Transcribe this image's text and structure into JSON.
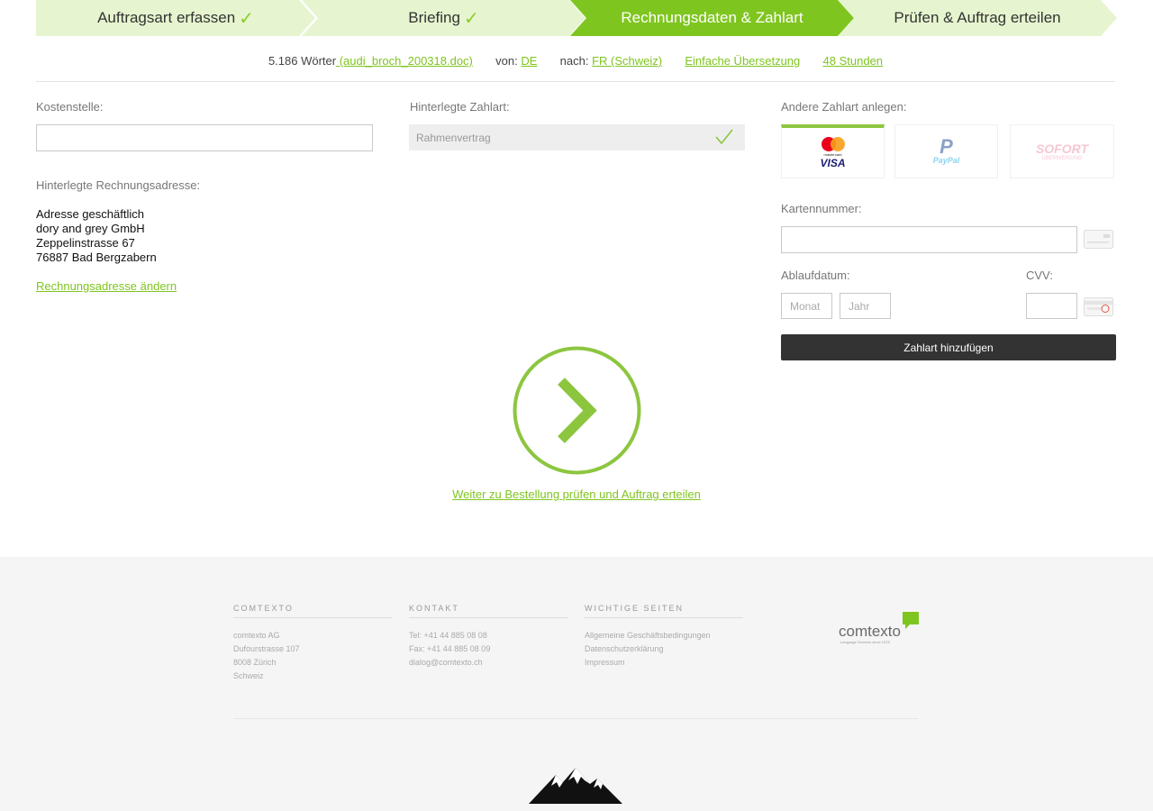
{
  "steps": [
    {
      "label": "Auftragsart erfassen",
      "done": true
    },
    {
      "label": "Briefing",
      "done": true
    },
    {
      "label": "Rechnungsdaten & Zahlart",
      "active": true
    },
    {
      "label": "Prüfen & Auftrag erteilen"
    }
  ],
  "summary": {
    "words": "5.186 Wörter",
    "file": " (audi_broch_200318.doc)",
    "from_label": "von:",
    "from_value": "DE",
    "to_label": "nach:",
    "to_value": "FR (Schweiz)",
    "type": "Einfache Übersetzung",
    "duration": "48 Stunden"
  },
  "left": {
    "cost_center_label": "Kostenstelle:",
    "cost_center_value": "",
    "address_label": "Hinterlegte Rechnungsadresse:",
    "address_lines": [
      "Adresse geschäftlich",
      "dory and grey GmbH",
      "Zeppelinstrasse 67",
      "76887 Bad Bergzabern"
    ],
    "change_address_link": "Rechnungsadresse ändern"
  },
  "middle": {
    "payment_label": "Hinterlegte Zahlart:",
    "payment_value": "Rahmenvertrag"
  },
  "right": {
    "new_payment_label": "Andere Zahlart anlegen:",
    "tabs": [
      {
        "name": "mastercard-visa",
        "text_top": "mastercard",
        "text_bottom": "VISA"
      },
      {
        "name": "paypal",
        "text": "PayPal"
      },
      {
        "name": "sofort",
        "text_top": "SOFORT",
        "text_bottom": "ÜBERWEISUNG"
      }
    ],
    "card_number_label": "Kartennummer:",
    "expiry_label": "Ablaufdatum:",
    "month_placeholder": "Monat",
    "year_placeholder": "Jahr",
    "cvv_label": "CVV:",
    "add_button": "Zahlart hinzufügen"
  },
  "next": {
    "link": "Weiter zu Bestellung prüfen und Auftrag erteilen"
  },
  "footer": {
    "col1_head": "COMTEXTO",
    "col1_lines": [
      "comtexto AG",
      "Dufourstrasse 107",
      "8008 Zürich",
      "Schweiz"
    ],
    "col2_head": "KONTAKT",
    "col2_lines": [
      "Tel: +41 44 885 08 08",
      "Fax: +41 44 885 08 09",
      "dialog@comtexto.ch"
    ],
    "col3_head": "WICHTIGE SEITEN",
    "col3_lines": [
      "Allgemeine Geschäftsbedingungen",
      "Datenschutzerklärung",
      "Impressum"
    ],
    "logo_text": "comtexto",
    "logo_sub": "Language Services since 1978"
  },
  "colors": {
    "accent": "#8cc63f",
    "light_step": "#e6f5cf",
    "active_step": "#7fc51f",
    "dark_button": "#333333"
  }
}
